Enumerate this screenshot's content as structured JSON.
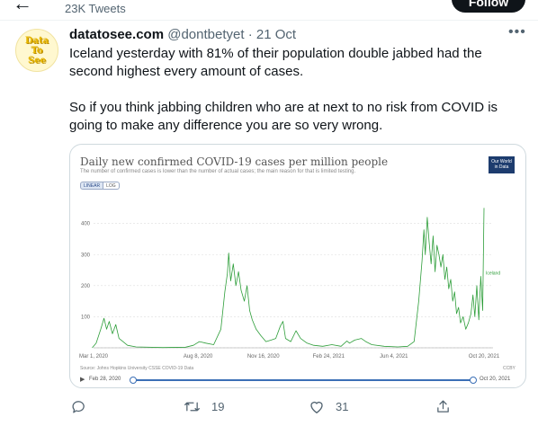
{
  "header": {
    "tweet_count": "23K Tweets",
    "follow_label": "Follow"
  },
  "avatar": {
    "lines": [
      "Data",
      "To",
      "See"
    ]
  },
  "tweet": {
    "display_name": "datatosee.com",
    "handle": "@dontbetyet",
    "dot": "·",
    "date": "21 Oct",
    "text_p1": "Iceland yesterday with 81% of their population double jabbed had the second highest every amount of cases.",
    "text_p2": "So if you think jabbing children who are at next to no risk from COVID is going to make any difference you are so very wrong."
  },
  "chart_card": {
    "title": "Daily new confirmed COVID-19 cases per million people",
    "subtitle": "The number of confirmed cases is lower than the number of actual cases; the main reason for that is limited testing.",
    "logo_line1": "Our World",
    "logo_line2": "in Data",
    "scale_linear": "LINEAR",
    "scale_log": "LOG",
    "source": "Source: Johns Hopkins University CSSE COVID-19 Data",
    "license": "CCBY",
    "timeline_start": "Feb 28, 2020",
    "timeline_end": "Oct 20, 2021"
  },
  "chart_data": {
    "type": "line",
    "title": "Daily new confirmed COVID-19 cases per million people",
    "subtitle": "The number of confirmed cases is lower than the number of actual cases; the main reason for that is limited testing.",
    "xlabel": "",
    "ylabel": "",
    "ylim": [
      0,
      480
    ],
    "yticks": [
      0,
      100,
      200,
      300,
      400
    ],
    "xticks": [
      "Mar 1, 2020",
      "Aug 8, 2020",
      "Nov 16, 2020",
      "Feb 24, 2021",
      "Jun 4, 2021",
      "Oct 20, 2021"
    ],
    "xtick_dates": [
      "2020-03-01",
      "2020-08-08",
      "2020-11-16",
      "2021-02-24",
      "2021-06-04",
      "2021-10-20"
    ],
    "grid": true,
    "scale": "linear",
    "series": [
      {
        "name": "Iceland",
        "color": "#2e9e3a",
        "points": [
          [
            "2020-02-28",
            0
          ],
          [
            "2020-03-05",
            15
          ],
          [
            "2020-03-12",
            60
          ],
          [
            "2020-03-17",
            95
          ],
          [
            "2020-03-21",
            60
          ],
          [
            "2020-03-25",
            85
          ],
          [
            "2020-03-30",
            45
          ],
          [
            "2020-04-04",
            75
          ],
          [
            "2020-04-09",
            30
          ],
          [
            "2020-04-15",
            20
          ],
          [
            "2020-04-22",
            8
          ],
          [
            "2020-05-05",
            3
          ],
          [
            "2020-06-15",
            1
          ],
          [
            "2020-07-20",
            2
          ],
          [
            "2020-08-01",
            8
          ],
          [
            "2020-08-10",
            20
          ],
          [
            "2020-08-20",
            15
          ],
          [
            "2020-09-01",
            10
          ],
          [
            "2020-09-12",
            60
          ],
          [
            "2020-09-18",
            180
          ],
          [
            "2020-09-22",
            240
          ],
          [
            "2020-09-24",
            305
          ],
          [
            "2020-09-27",
            215
          ],
          [
            "2020-10-01",
            270
          ],
          [
            "2020-10-05",
            200
          ],
          [
            "2020-10-09",
            245
          ],
          [
            "2020-10-13",
            185
          ],
          [
            "2020-10-18",
            150
          ],
          [
            "2020-10-22",
            200
          ],
          [
            "2020-10-26",
            120
          ],
          [
            "2020-10-30",
            90
          ],
          [
            "2020-11-05",
            60
          ],
          [
            "2020-11-12",
            40
          ],
          [
            "2020-11-20",
            20
          ],
          [
            "2020-11-28",
            25
          ],
          [
            "2020-12-05",
            30
          ],
          [
            "2020-12-12",
            70
          ],
          [
            "2020-12-16",
            85
          ],
          [
            "2020-12-20",
            30
          ],
          [
            "2020-12-28",
            20
          ],
          [
            "2021-01-05",
            55
          ],
          [
            "2021-01-12",
            30
          ],
          [
            "2021-01-22",
            15
          ],
          [
            "2021-02-01",
            8
          ],
          [
            "2021-02-15",
            5
          ],
          [
            "2021-03-01",
            10
          ],
          [
            "2021-03-15",
            5
          ],
          [
            "2021-03-24",
            22
          ],
          [
            "2021-03-28",
            15
          ],
          [
            "2021-04-05",
            25
          ],
          [
            "2021-04-15",
            30
          ],
          [
            "2021-04-22",
            20
          ],
          [
            "2021-05-01",
            10
          ],
          [
            "2021-05-20",
            5
          ],
          [
            "2021-06-10",
            3
          ],
          [
            "2021-06-25",
            5
          ],
          [
            "2021-07-05",
            20
          ],
          [
            "2021-07-12",
            150
          ],
          [
            "2021-07-17",
            280
          ],
          [
            "2021-07-20",
            380
          ],
          [
            "2021-07-22",
            300
          ],
          [
            "2021-07-25",
            420
          ],
          [
            "2021-07-28",
            340
          ],
          [
            "2021-07-31",
            270
          ],
          [
            "2021-08-03",
            360
          ],
          [
            "2021-08-06",
            245
          ],
          [
            "2021-08-09",
            330
          ],
          [
            "2021-08-12",
            300
          ],
          [
            "2021-08-15",
            260
          ],
          [
            "2021-08-18",
            300
          ],
          [
            "2021-08-21",
            220
          ],
          [
            "2021-08-24",
            260
          ],
          [
            "2021-08-27",
            190
          ],
          [
            "2021-08-30",
            220
          ],
          [
            "2021-09-02",
            150
          ],
          [
            "2021-09-05",
            180
          ],
          [
            "2021-09-08",
            110
          ],
          [
            "2021-09-11",
            130
          ],
          [
            "2021-09-14",
            80
          ],
          [
            "2021-09-18",
            100
          ],
          [
            "2021-09-22",
            60
          ],
          [
            "2021-09-26",
            80
          ],
          [
            "2021-09-30",
            110
          ],
          [
            "2021-10-03",
            170
          ],
          [
            "2021-10-06",
            100
          ],
          [
            "2021-10-09",
            200
          ],
          [
            "2021-10-12",
            90
          ],
          [
            "2021-10-15",
            230
          ],
          [
            "2021-10-18",
            120
          ],
          [
            "2021-10-20",
            450
          ]
        ]
      }
    ]
  },
  "actions": {
    "reply": "",
    "retweets": "19",
    "likes": "31"
  }
}
